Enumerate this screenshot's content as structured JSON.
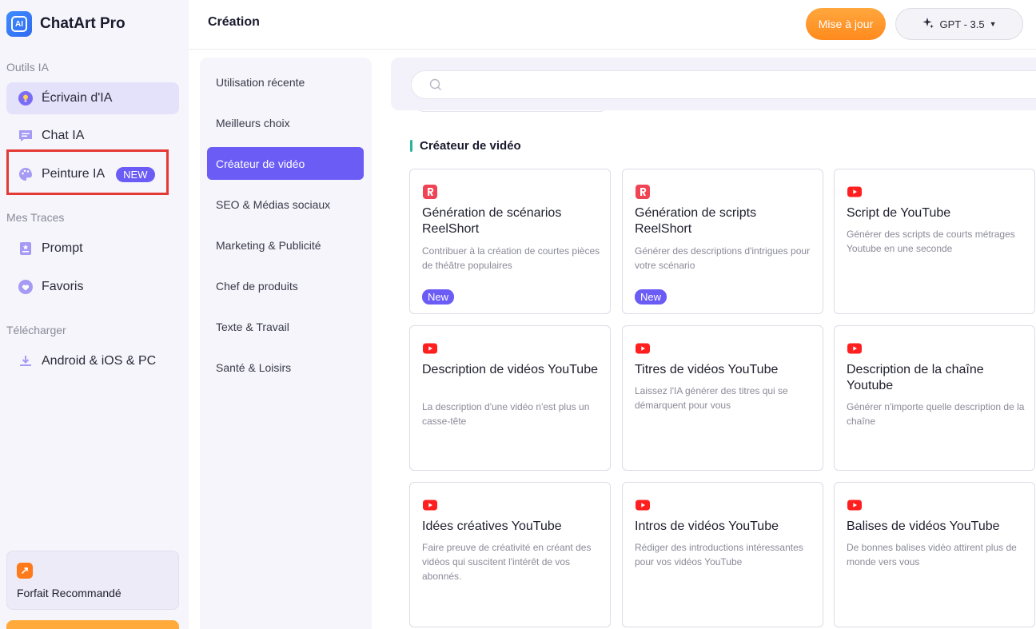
{
  "app": {
    "name": "ChatArt Pro"
  },
  "sidebar": {
    "sections": {
      "tools": "Outils IA",
      "traces": "Mes Traces",
      "download": "Télécharger"
    },
    "items": [
      {
        "label": "Écrivain d'IA",
        "icon": "lightbulb-icon"
      },
      {
        "label": "Chat IA",
        "icon": "chat-bubble-icon"
      },
      {
        "label": "Peinture IA",
        "icon": "palette-icon",
        "badge": "NEW"
      },
      {
        "label": "Prompt",
        "icon": "prompt-icon"
      },
      {
        "label": "Favoris",
        "icon": "heart-icon"
      },
      {
        "label": "Android & iOS & PC",
        "icon": "download-icon"
      }
    ],
    "plan": {
      "label": "Forfait Recommandé",
      "icon": "arrow-up-right-icon"
    }
  },
  "header": {
    "title": "Création",
    "upgrade_label": "Mise à jour",
    "model_label": "GPT - 3.5",
    "model_icon": "sparkle-icon"
  },
  "categories": [
    {
      "label": "Utilisation récente"
    },
    {
      "label": "Meilleurs choix"
    },
    {
      "label": "Créateur de vidéo",
      "active": true
    },
    {
      "label": "SEO & Médias sociaux"
    },
    {
      "label": "Marketing & Publicité"
    },
    {
      "label": "Chef de produits"
    },
    {
      "label": "Texte & Travail"
    },
    {
      "label": "Santé & Loisirs"
    }
  ],
  "search": {
    "placeholder": ""
  },
  "section": {
    "title": "Créateur de vidéo"
  },
  "cards": [
    {
      "title": "Génération de scénarios ReelShort",
      "desc": "Contribuer à la création de courtes pièces de théâtre populaires",
      "icon": "reelshort-icon",
      "badge": "New"
    },
    {
      "title": "Génération de scripts ReelShort",
      "desc": "Générer des descriptions d'intrigues pour votre scénario",
      "icon": "reelshort-icon",
      "badge": "New"
    },
    {
      "title": "Script de YouTube",
      "desc": "Générer des scripts de courts métrages Youtube en une seconde",
      "icon": "youtube-icon"
    },
    {
      "title": "Description de vidéos YouTube",
      "desc": "La description d'une vidéo n'est plus un casse-tête",
      "icon": "youtube-icon"
    },
    {
      "title": "Titres de vidéos YouTube",
      "desc": "Laissez l'IA générer des titres qui se démarquent pour vous",
      "icon": "youtube-icon"
    },
    {
      "title": "Description de la chaîne Youtube",
      "desc": "Générer n'importe quelle description de la chaîne",
      "icon": "youtube-icon"
    },
    {
      "title": "Idées créatives YouTube",
      "desc": "Faire preuve de créativité en créant des vidéos qui suscitent l'intérêt de vos abonnés.",
      "icon": "youtube-icon"
    },
    {
      "title": "Intros de vidéos YouTube",
      "desc": "Rédiger des introductions intéressantes pour vos vidéos YouTube",
      "icon": "youtube-icon"
    },
    {
      "title": "Balises de vidéos YouTube",
      "desc": "De bonnes balises vidéo attirent plus de monde vers vous",
      "icon": "youtube-icon"
    }
  ],
  "colors": {
    "accent": "#6b5cf6",
    "upgrade": "#ff8a1e",
    "youtube": "#ff1f1f",
    "reelshort": "#f04455",
    "highlight": "#e53935"
  }
}
